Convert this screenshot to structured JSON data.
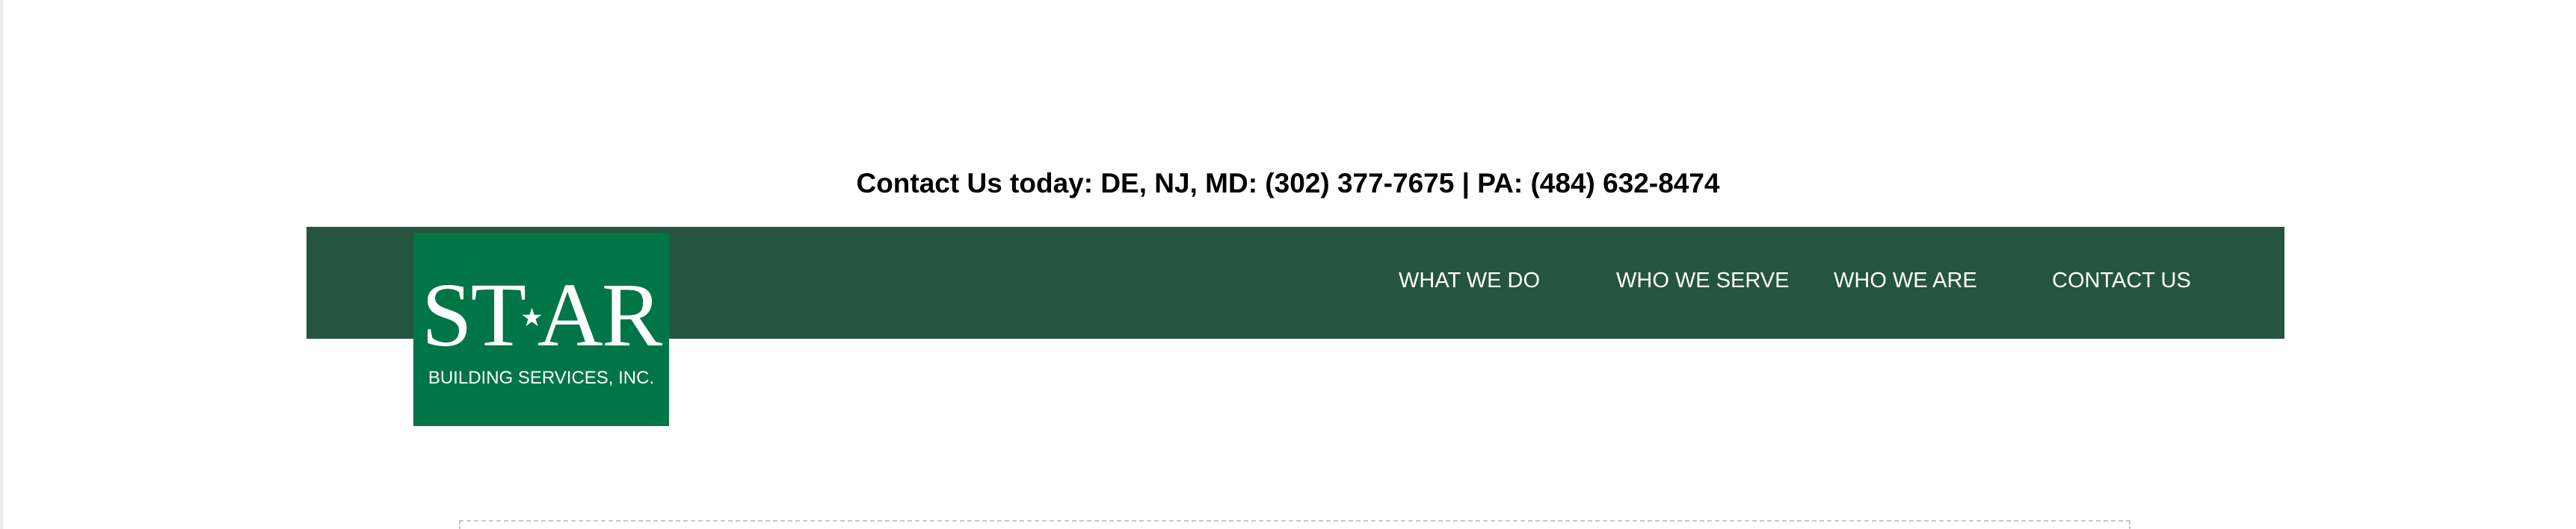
{
  "header": {
    "contact_line": "Contact Us today: DE, NJ, MD: (302) 377-7675 | PA: (484) 632-8474"
  },
  "logo": {
    "wordmark_left": "ST",
    "wordmark_right": "AR",
    "star_glyph": "★",
    "subtitle": "BUILDING SERVICES, INC.",
    "brand_color": "#007545"
  },
  "nav": {
    "background_color": "#25553f",
    "items": [
      {
        "label": "WHAT WE DO"
      },
      {
        "label": "WHO WE SERVE"
      },
      {
        "label": "WHO WE ARE"
      },
      {
        "label": "CONTACT US"
      }
    ]
  }
}
